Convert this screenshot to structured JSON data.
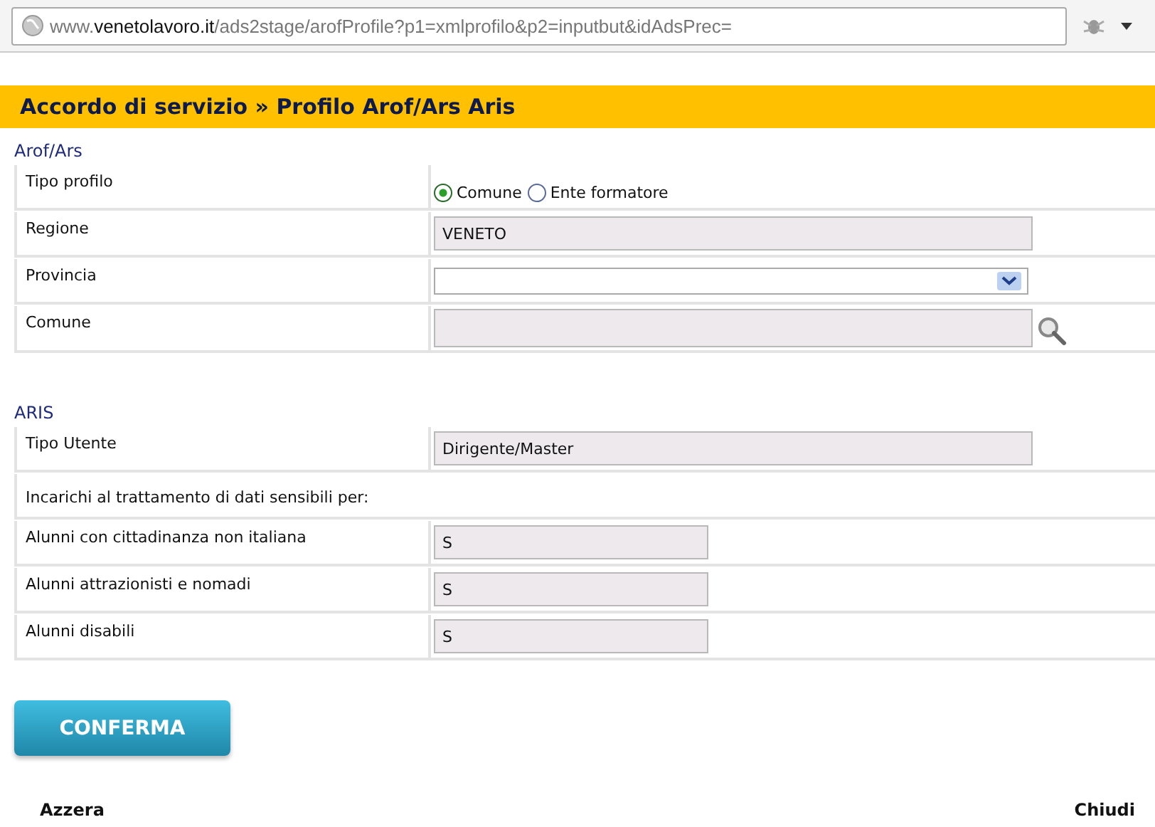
{
  "address_bar": {
    "prefix": "www.",
    "domain": "venetolavoro.it",
    "path": "/ads2stage/arofProfile?p1=xmlprofilo&p2=inputbut&idAdsPrec="
  },
  "page_title": "Accordo di servizio » Profilo Arof/Ars Aris",
  "sections": [
    {
      "title": "Arof/Ars",
      "rows": [
        {
          "kind": "radio",
          "label": "Tipo profilo",
          "options": [
            {
              "label": "Comune",
              "selected": true
            },
            {
              "label": "Ente formatore",
              "selected": false
            }
          ]
        },
        {
          "kind": "field",
          "label": "Regione",
          "value": "VENETO"
        },
        {
          "kind": "select",
          "label": "Provincia"
        },
        {
          "kind": "lookup",
          "label": "Comune"
        }
      ]
    },
    {
      "title": "ARIS",
      "rows": [
        {
          "kind": "field",
          "label": "Tipo Utente",
          "value": "Dirigente/Master"
        },
        {
          "kind": "note",
          "label": "Incarichi al trattamento di dati sensibili per:"
        },
        {
          "kind": "short",
          "label": "Alunni con cittadinanza non italiana",
          "value": "S"
        },
        {
          "kind": "short",
          "label": "Alunni attrazionisti e nomadi",
          "value": "S"
        },
        {
          "kind": "short",
          "label": "Alunni disabili",
          "value": "S"
        }
      ]
    }
  ],
  "confirm_button": "CONFERMA",
  "reset_link": "Azzera",
  "close_link": "Chiudi"
}
